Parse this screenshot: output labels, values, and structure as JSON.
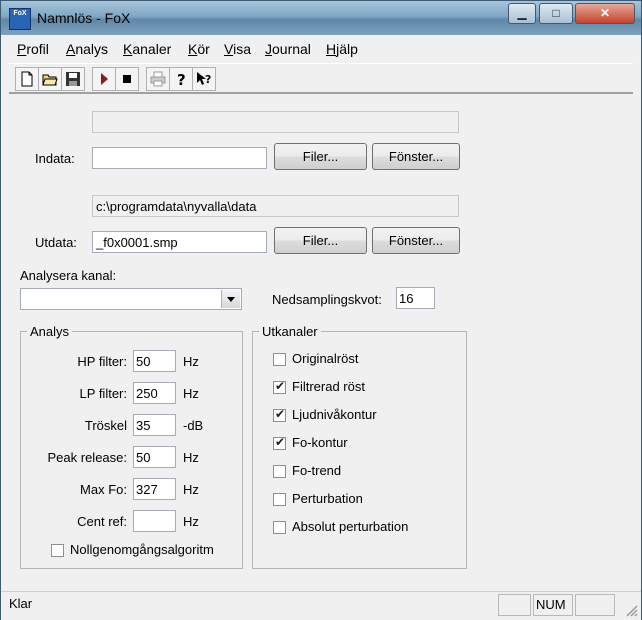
{
  "window": {
    "title": "Namnlös - FoX",
    "icon_label": "FoX"
  },
  "menu": [
    {
      "label": "Profil"
    },
    {
      "label": "Analys"
    },
    {
      "label": "Kanaler"
    },
    {
      "label": "Kör"
    },
    {
      "label": "Visa"
    },
    {
      "label": "Journal"
    },
    {
      "label": "Hjälp"
    }
  ],
  "toolbar": [
    "new-file-icon",
    "open-folder-icon",
    "save-icon",
    "play-icon",
    "stop-icon",
    "print-icon",
    "help-icon",
    "context-help-icon"
  ],
  "input": {
    "info": "",
    "label": "Indata:",
    "value": "",
    "files_button": "Filer...",
    "window_button": "Fönster..."
  },
  "output": {
    "path": "c:\\programdata\\nyvalla\\data",
    "label": "Utdata:",
    "value": "_f0x0001.smp",
    "files_button": "Filer...",
    "window_button": "Fönster..."
  },
  "channel": {
    "label": "Analysera kanal:",
    "value": ""
  },
  "downsampling": {
    "label": "Nedsamplingskvot:",
    "value": "16"
  },
  "analysis": {
    "title": "Analys",
    "hp_label": "HP filter:",
    "hp_value": "50",
    "hp_unit": "Hz",
    "lp_label": "LP filter:",
    "lp_value": "250",
    "lp_unit": "Hz",
    "threshold_label": "Tröskel",
    "threshold_value": "35",
    "threshold_unit": "-dB",
    "peak_label": "Peak release:",
    "peak_value": "50",
    "peak_unit": "Hz",
    "maxfo_label": "Max Fo:",
    "maxfo_value": "327",
    "maxfo_unit": "Hz",
    "centref_label": "Cent ref:",
    "centref_value": "",
    "centref_unit": "Hz",
    "zero_cross_label": "Nollgenomgångsalgoritm"
  },
  "outchannels": {
    "title": "Utkanaler",
    "items": [
      {
        "label": "Originalröst",
        "checked": false
      },
      {
        "label": "Filtrerad röst",
        "checked": true
      },
      {
        "label": "Ljudnivåkontur",
        "checked": true
      },
      {
        "label": "Fo-kontur",
        "checked": true
      },
      {
        "label": "Fo-trend",
        "checked": false
      },
      {
        "label": "Perturbation",
        "checked": false
      },
      {
        "label": "Absolut perturbation",
        "checked": false
      }
    ]
  },
  "status": {
    "text": "Klar",
    "num": "NUM"
  }
}
